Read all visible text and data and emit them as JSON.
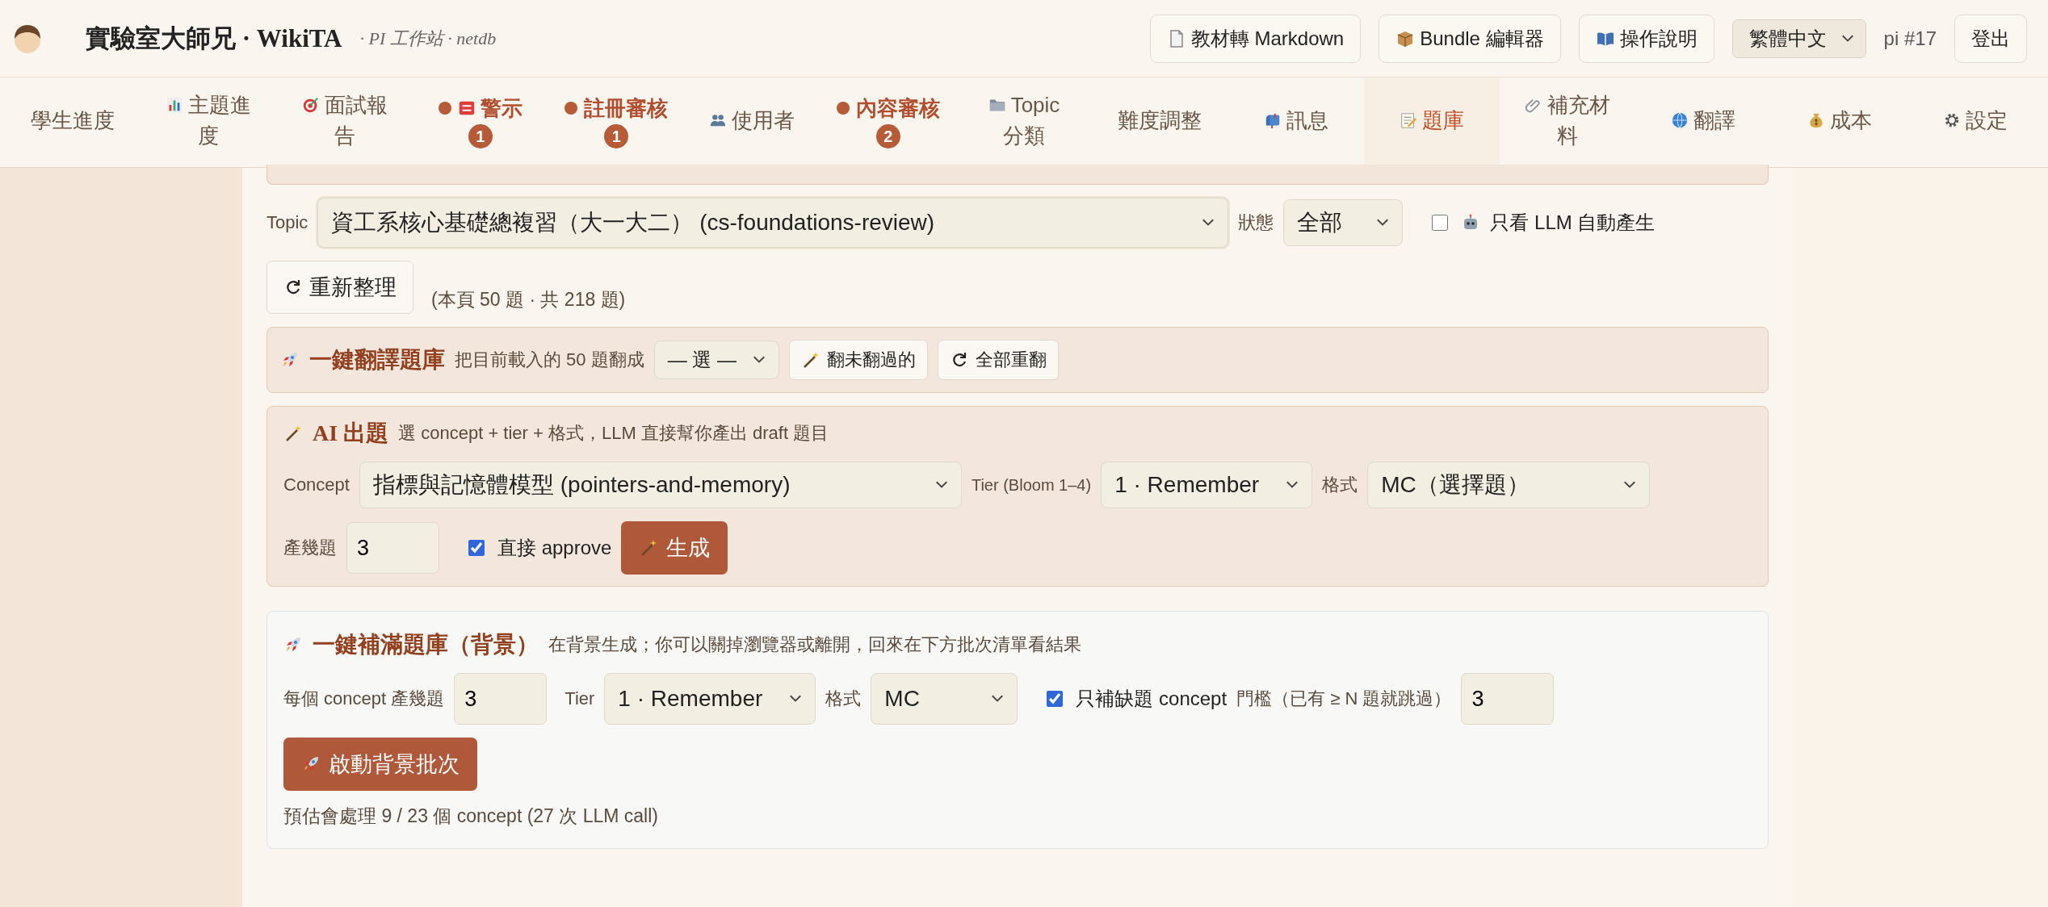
{
  "header": {
    "title": "實驗室大師兄 · WikiTA",
    "subtitle": "· PI 工作站 · netdb",
    "buttons": [
      {
        "label": "教材轉 Markdown"
      },
      {
        "label": "Bundle 編輯器"
      },
      {
        "label": "操作說明"
      }
    ],
    "language": "繁體中文",
    "user": "pi #17",
    "logout": "登出"
  },
  "nav": [
    {
      "label": "學生進度",
      "alert": false,
      "selected": false
    },
    {
      "label": "主題進度",
      "alert": false,
      "selected": false
    },
    {
      "label": "面試報告",
      "alert": false,
      "selected": false
    },
    {
      "label": "警示",
      "alert": true,
      "badge": "1",
      "selected": false
    },
    {
      "label": "註冊審核",
      "alert": true,
      "badge": "1",
      "selected": false
    },
    {
      "label": "使用者",
      "alert": false,
      "selected": false
    },
    {
      "label": "內容審核",
      "alert": true,
      "badge": "2",
      "selected": false
    },
    {
      "label": "Topic 分類",
      "alert": false,
      "selected": false
    },
    {
      "label": "難度調整",
      "alert": false,
      "selected": false
    },
    {
      "label": "訊息",
      "alert": false,
      "selected": false
    },
    {
      "label": "題庫",
      "alert": false,
      "selected": true
    },
    {
      "label": "補充材料",
      "alert": false,
      "selected": false
    },
    {
      "label": "翻譯",
      "alert": false,
      "selected": false
    },
    {
      "label": "成本",
      "alert": false,
      "selected": false
    },
    {
      "label": "設定",
      "alert": false,
      "selected": false
    }
  ],
  "filters": {
    "topic_label": "Topic",
    "topic": "資工系核心基礎總複習（大一大二） (cs-foundations-review)",
    "status_label": "狀態",
    "status": "全部",
    "llm_only": {
      "label": "只看 LLM 自動產生",
      "checked": false
    },
    "refresh_button": "重新整理",
    "count": "(本頁 50 題 · 共 218 題)"
  },
  "translate": {
    "title": "一鍵翻譯題庫",
    "hint": "把目前載入的 50 題翻成",
    "language": "— 選 —",
    "buttons": [
      {
        "label": "翻未翻過的"
      },
      {
        "label": "全部重翻"
      }
    ]
  },
  "ai": {
    "title": "AI 出題",
    "hint": "選 concept + tier + 格式，LLM 直接幫你產出 draft 題目",
    "concept_label": "Concept",
    "concept": "指標與記憶體模型 (pointers-and-memory)",
    "tier_label": "Tier (Bloom 1–4)",
    "tier": "1 · Remember",
    "format_label": "格式",
    "format": "MC（選擇題）",
    "count_label": "產幾題",
    "count": "3",
    "approve": {
      "label": "直接 approve",
      "checked": true
    },
    "generate": "生成"
  },
  "fill": {
    "title": "一鍵補滿題庫（背景）",
    "hint": "在背景生成；你可以關掉瀏覽器或離開，回來在下方批次清單看結果",
    "per_label": "每個 concept 產幾題",
    "per": "3",
    "tier_label": "Tier",
    "tier": "1 · Remember",
    "format_label": "格式",
    "format": "MC",
    "missing_only": {
      "label": "只補缺題 concept",
      "checked": true
    },
    "threshold_label": "門檻（已有 ≥ N 題就跳過）",
    "threshold": "3",
    "start": "啟動背景批次",
    "estimate": "預估會處理 9 / 23 個 concept (27 次 LLM call)"
  }
}
